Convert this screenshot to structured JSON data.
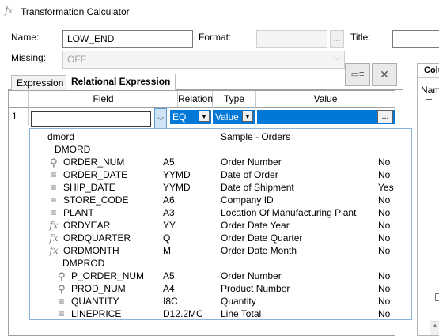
{
  "window": {
    "title": "Transformation Calculator",
    "icon": "fx-icon"
  },
  "form": {
    "name_label": "Name:",
    "name_value": "LOW_END",
    "format_label": "Format:",
    "format_value": "",
    "format_button": "...",
    "title_label": "Title:",
    "title_value": "",
    "missing_label": "Missing:",
    "missing_value": "OFF"
  },
  "toolbar": {
    "expand_icon": "panel-icon",
    "close_label": "✕"
  },
  "tabs": [
    {
      "label": "Expression"
    },
    {
      "label": "Relational Expression"
    }
  ],
  "grid": {
    "headers": {
      "field": "Field",
      "relation": "Relation",
      "type": "Type",
      "value": "Value"
    },
    "row": {
      "index": "1",
      "field_value": "",
      "relation_value": "EQ",
      "type_value": "Value",
      "value_value": "",
      "value_button": "..."
    }
  },
  "right_panel": {
    "header": "Colu",
    "sub": "Nam"
  },
  "dropdown": {
    "root": {
      "name": "dmord",
      "description": "Sample - Orders"
    },
    "segments": [
      {
        "name": "DMORD",
        "fields": [
          {
            "icon": "key",
            "name": "ORDER_NUM",
            "format": "A5",
            "title": "Order Number",
            "missing": "No"
          },
          {
            "icon": "field",
            "name": "ORDER_DATE",
            "format": "YYMD",
            "title": "Date of Order",
            "missing": "No"
          },
          {
            "icon": "field",
            "name": "SHIP_DATE",
            "format": "YYMD",
            "title": "Date of Shipment",
            "missing": "Yes"
          },
          {
            "icon": "field",
            "name": "STORE_CODE",
            "format": "A6",
            "title": "Company ID",
            "missing": "No"
          },
          {
            "icon": "field",
            "name": "PLANT",
            "format": "A3",
            "title": "Location Of Manufacturing Plant",
            "missing": "No"
          },
          {
            "icon": "fx",
            "name": "ORDYEAR",
            "format": "YY",
            "title": "Order Date Year",
            "missing": "No"
          },
          {
            "icon": "fx",
            "name": "ORDQUARTER",
            "format": "Q",
            "title": "Order Date Quarter",
            "missing": "No"
          },
          {
            "icon": "fx",
            "name": "ORDMONTH",
            "format": "M",
            "title": "Order Date Month",
            "missing": "No"
          }
        ]
      },
      {
        "name": "DMPROD",
        "fields": [
          {
            "icon": "key",
            "name": "P_ORDER_NUM",
            "format": "A5",
            "title": "Order Number",
            "missing": "No"
          },
          {
            "icon": "key",
            "name": "PROD_NUM",
            "format": "A4",
            "title": "Product Number",
            "missing": "No"
          },
          {
            "icon": "field",
            "name": "QUANTITY",
            "format": "I8C",
            "title": "Quantity",
            "missing": "No"
          },
          {
            "icon": "field",
            "name": "LINEPRICE",
            "format": "D12.2MC",
            "title": "Line Total",
            "missing": "No"
          }
        ]
      }
    ]
  },
  "colors": {
    "selection": "#0078d7",
    "border": "#a0a0a0",
    "dropdown_border": "#8ab4d9"
  }
}
